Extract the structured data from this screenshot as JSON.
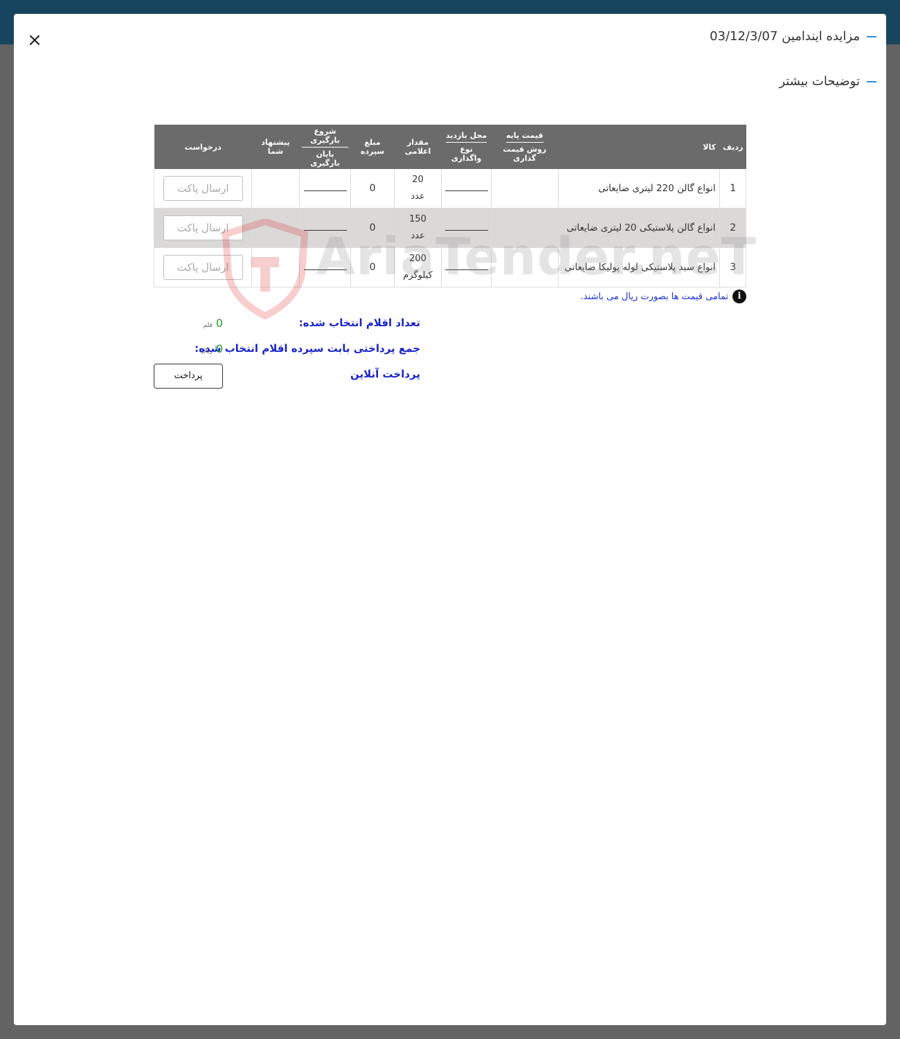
{
  "modal": {
    "title": "مزایده ایندامین 03/12/3/07",
    "subtitle": "توضیحات بیشتر",
    "close_label": "×"
  },
  "table": {
    "headers": {
      "row": "ردیف",
      "item": "کالا",
      "base_price": "قیمت پایه",
      "pricing_method": "روش قیمت گذاری",
      "visit_place": "محل بازدید",
      "assignment_type": "نوع واگذاری",
      "quantity": "مقدار اعلامی",
      "deposit": "مبلغ سپرده",
      "loading_start": "شروع بارگیری",
      "loading_end": "پایان بارگیری",
      "your_offer": "پیشنهاد شما",
      "request": "درخواست"
    },
    "rows": [
      {
        "no": "1",
        "name": "انواع گالن 220 لیتری ضایعاتی",
        "qty": "20",
        "unit": "عدد",
        "deposit": "0",
        "button": "ارسال پاکت"
      },
      {
        "no": "2",
        "name": "انواع گالن پلاستیکی 20 لیتری ضایعاتی",
        "qty": "150",
        "unit": "عدد",
        "deposit": "0",
        "button": "ارسال پاکت"
      },
      {
        "no": "3",
        "name": "انواع سبد پلاستیکی لوله پولیکا ضایعاتی",
        "qty": "200",
        "unit": "کیلوگرم",
        "deposit": "0",
        "button": "ارسال پاکت"
      }
    ]
  },
  "watermark": "AriaTender.neT",
  "note": "تمامی قیمت ها بصورت ریال می باشند.",
  "summary": {
    "count_label": "تعداد اقلام انتخاب شده:",
    "count_value": "0",
    "count_unit": "قلم",
    "total_label": "جمع پرداختی بابت سپرده اقلام انتخاب شده:",
    "total_value": "0",
    "total_unit": "ریال",
    "online_label": "پرداخت آنلاین",
    "pay_button": "پرداخت"
  },
  "colors": {
    "header_bg": "#6b6b6b",
    "alt_row_bg": "#dbd8d8",
    "accent_blue": "#1a24c8",
    "value_green": "#1e9b2a",
    "topbar": "#17455f"
  }
}
